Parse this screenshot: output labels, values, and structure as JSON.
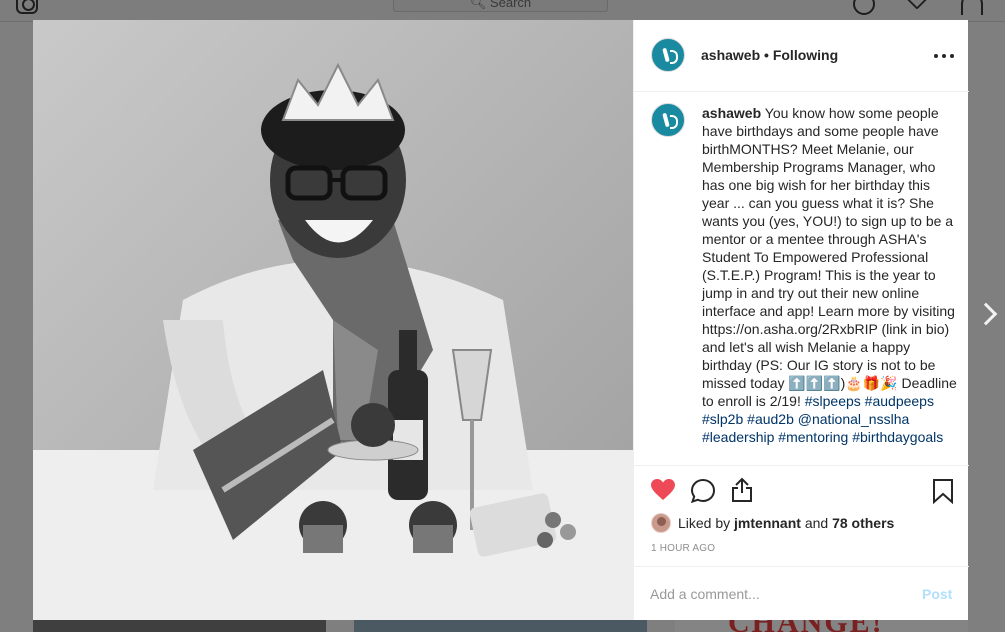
{
  "header": {
    "search_placeholder": "Search",
    "icons": [
      "instagram-logo-icon",
      "compass-icon",
      "heart-icon",
      "profile-icon"
    ]
  },
  "grid": {
    "tile3_text": "CHANGE!"
  },
  "post": {
    "author": "ashaweb",
    "separator": " • ",
    "follow_status": "Following",
    "caption": {
      "username": "ashaweb",
      "text": "You know how some people have birthdays and some people have birthMONTHS? Meet Melanie, our Membership Programs Manager, who has one big wish for her birthday this year ... can you guess what it is? She wants you (yes, YOU!) to sign up to be a mentor or a mentee through ASHA's Student To Empowered Professional (S.T.E.P.) Program! This is the year to jump in and try out their new online interface and app! Learn more by visiting https://on.asha.org/2RxbRIP (link in bio) and let's all wish Melanie a happy birthday (PS: Our IG story is not to be missed today ⬆️⬆️⬆️)🎂🎁🎉 Deadline to enroll is 2/19!",
      "hashtags": [
        "#slpeeps",
        "#audpeeps",
        "#slp2b",
        "#aud2b",
        "@national_nsslha",
        "#leadership",
        "#mentoring",
        "#birthdaygoals"
      ]
    },
    "likes": {
      "prefix": "Liked by",
      "user": "jmtennant",
      "conjunction": "and",
      "others": "78 others"
    },
    "timestamp": "1 hour ago",
    "comment_placeholder": "Add a comment...",
    "post_button": "Post",
    "colors": {
      "like_red": "#ed4956",
      "hashtag": "#003569",
      "post_disabled": "#b2dffc",
      "avatar_teal": "#1a8aa0"
    }
  }
}
